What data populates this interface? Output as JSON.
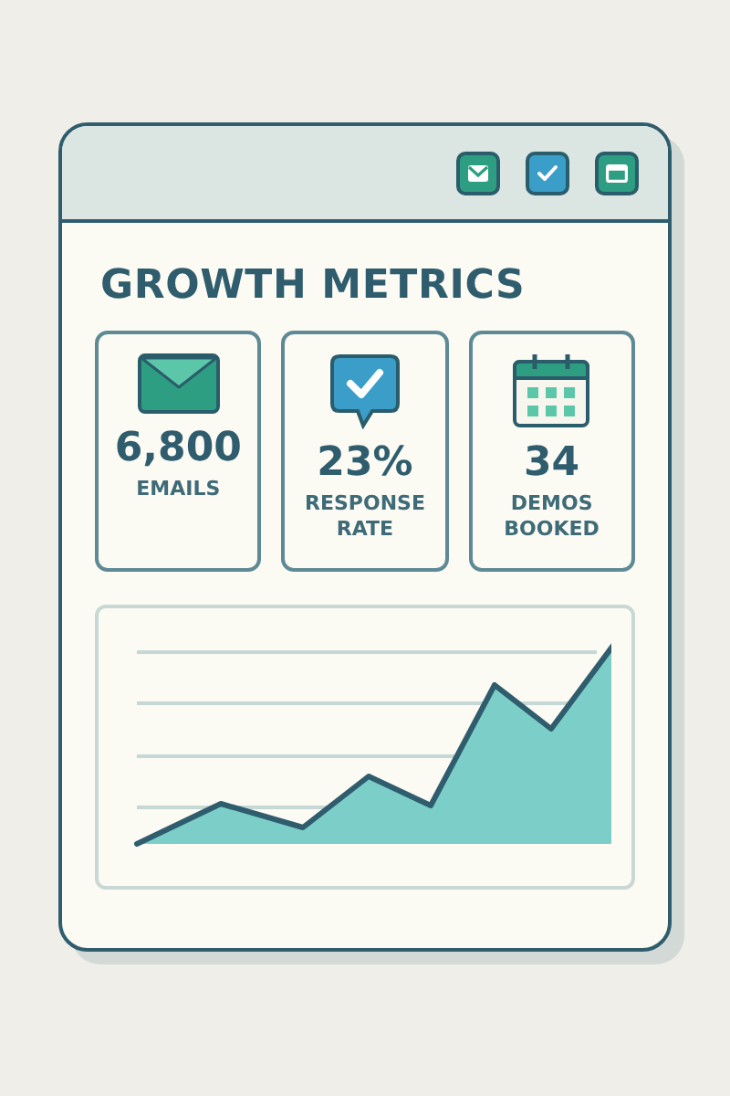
{
  "window": {
    "buttons": [
      {
        "color": "#2e9e82"
      },
      {
        "color": "#3a9ec8"
      },
      {
        "color": "#2e9e82"
      }
    ]
  },
  "title": "GROWTH METRICS",
  "metrics": [
    {
      "value": "6,800",
      "label": "EMAILS"
    },
    {
      "value": "23%",
      "label": "RESPONSE RATE"
    },
    {
      "value": "34",
      "label": "DEMOS BOOKED"
    }
  ]
}
